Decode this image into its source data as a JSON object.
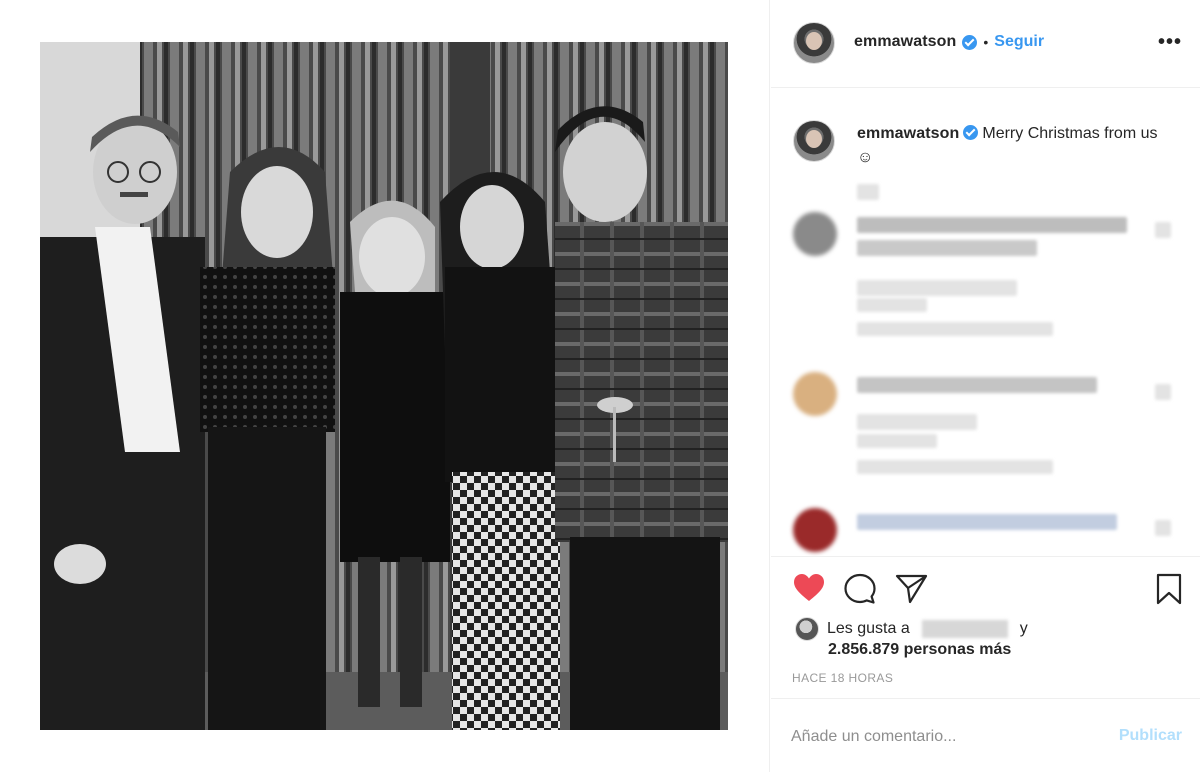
{
  "post": {
    "username": "emmawatson",
    "follow_label": "Seguir",
    "separator": "•",
    "more_label": "•••"
  },
  "caption": {
    "username": "emmawatson",
    "text": "Merry Christmas from us ☺"
  },
  "likes": {
    "prefix": "Les gusta a",
    "suffix": "y",
    "count_line": "2.856.879 personas más"
  },
  "timestamp": "HACE 18 HORAS",
  "comment": {
    "placeholder": "Añade un comentario...",
    "publish_label": "Publicar"
  },
  "colors": {
    "accent": "#3897f0",
    "like_heart": "#ed4956",
    "publish_disabled": "#b2dffc"
  },
  "icons": [
    "verified-badge-icon",
    "more-options-icon",
    "heart-icon",
    "comment-icon",
    "share-icon",
    "bookmark-icon"
  ]
}
